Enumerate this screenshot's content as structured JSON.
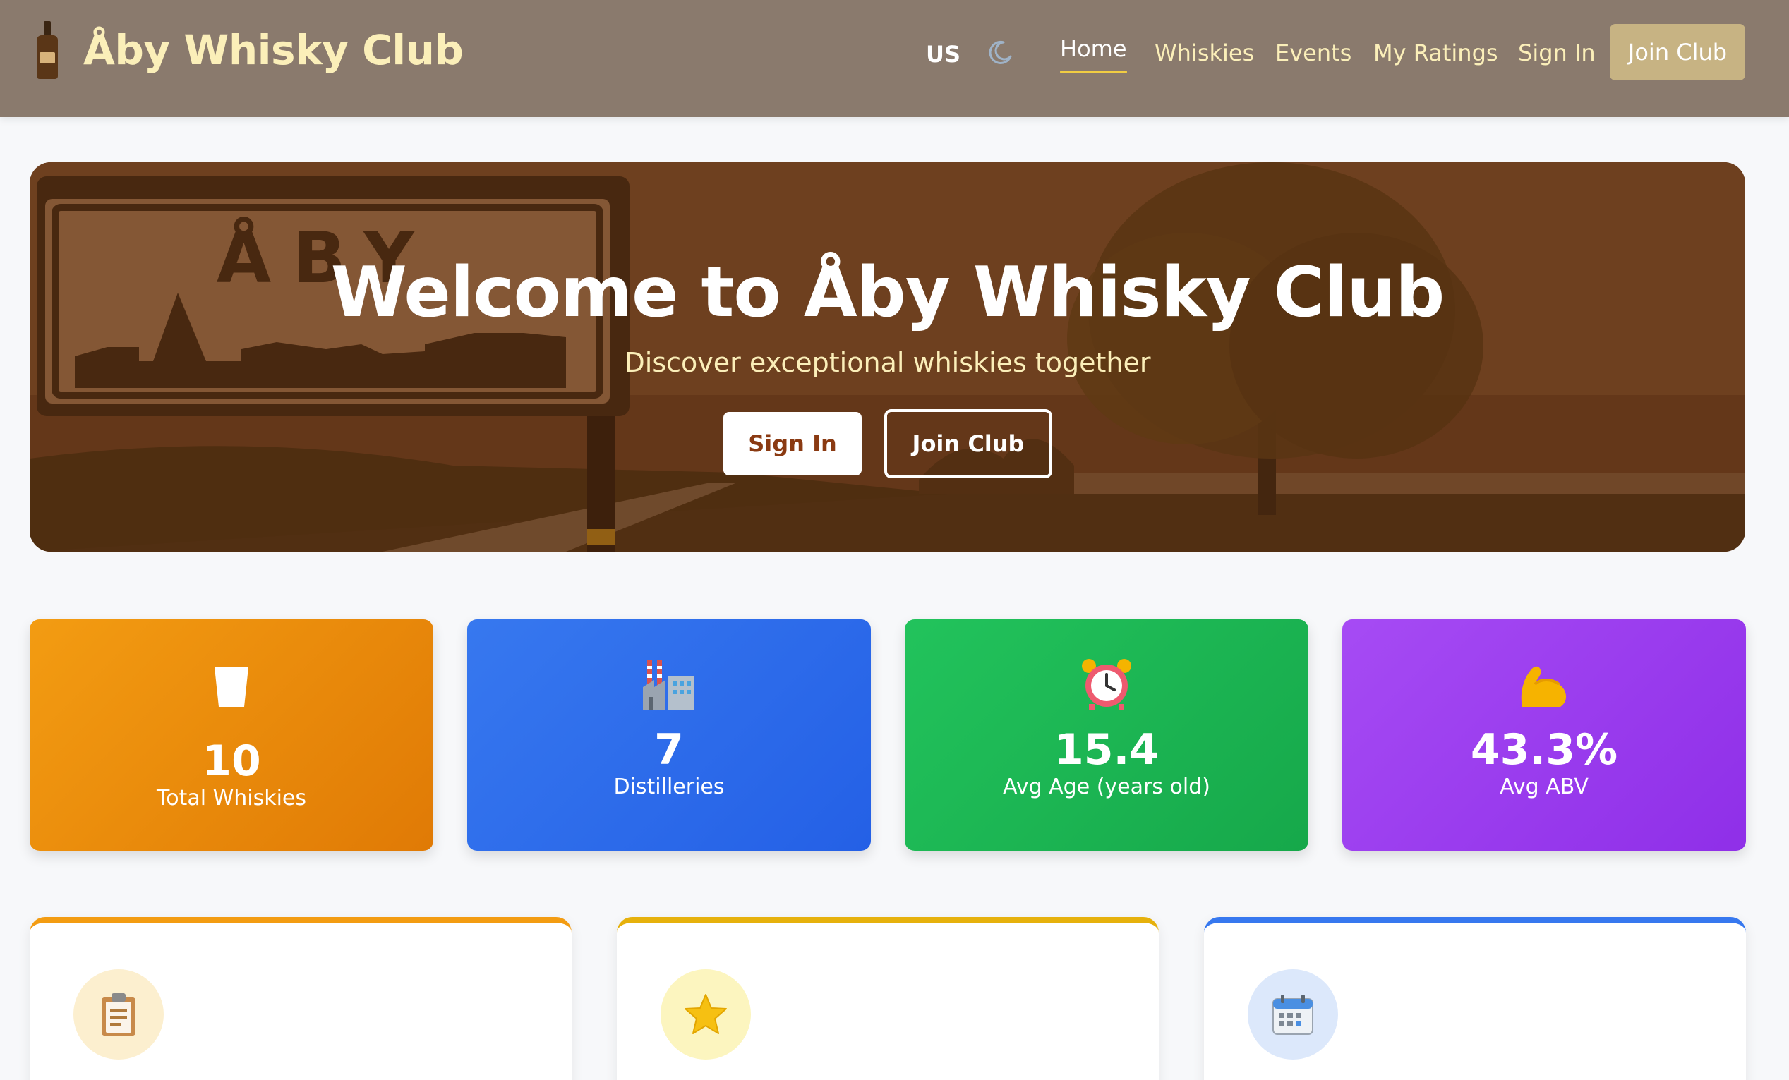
{
  "header": {
    "brand_title": "Åby Whisky Club",
    "logo_icon": "whisky-bottle-icon",
    "language": "US",
    "theme_icon": "moon-icon",
    "nav": [
      {
        "label": "Home",
        "active": true
      },
      {
        "label": "Whiskies"
      },
      {
        "label": "Events"
      },
      {
        "label": "My Ratings"
      },
      {
        "label": "Sign In"
      }
    ],
    "join_label": "Join Club"
  },
  "hero": {
    "title": "Welcome to Åby Whisky Club",
    "subtitle": "Discover exceptional whiskies together",
    "sign_in_label": "Sign In",
    "join_label": "Join Club",
    "sign_text": "ÅBY"
  },
  "stats": [
    {
      "icon": "glass-icon",
      "value": "10",
      "label": "Total Whiskies",
      "color": "#f39c12"
    },
    {
      "icon": "factory-icon",
      "value": "7",
      "label": "Distilleries",
      "color": "#3778ef"
    },
    {
      "icon": "alarm-clock-icon",
      "value": "15.4",
      "label": "Avg Age (years old)",
      "color": "#22c35c"
    },
    {
      "icon": "flexed-biceps-icon",
      "value": "43.3%",
      "label": "Avg ABV",
      "color": "#a64bf4"
    }
  ],
  "features": [
    {
      "icon": "clipboard-icon",
      "accent": "#f39c12"
    },
    {
      "icon": "star-icon",
      "accent": "#e6b10c"
    },
    {
      "icon": "calendar-icon",
      "accent": "#3778ef"
    }
  ]
}
